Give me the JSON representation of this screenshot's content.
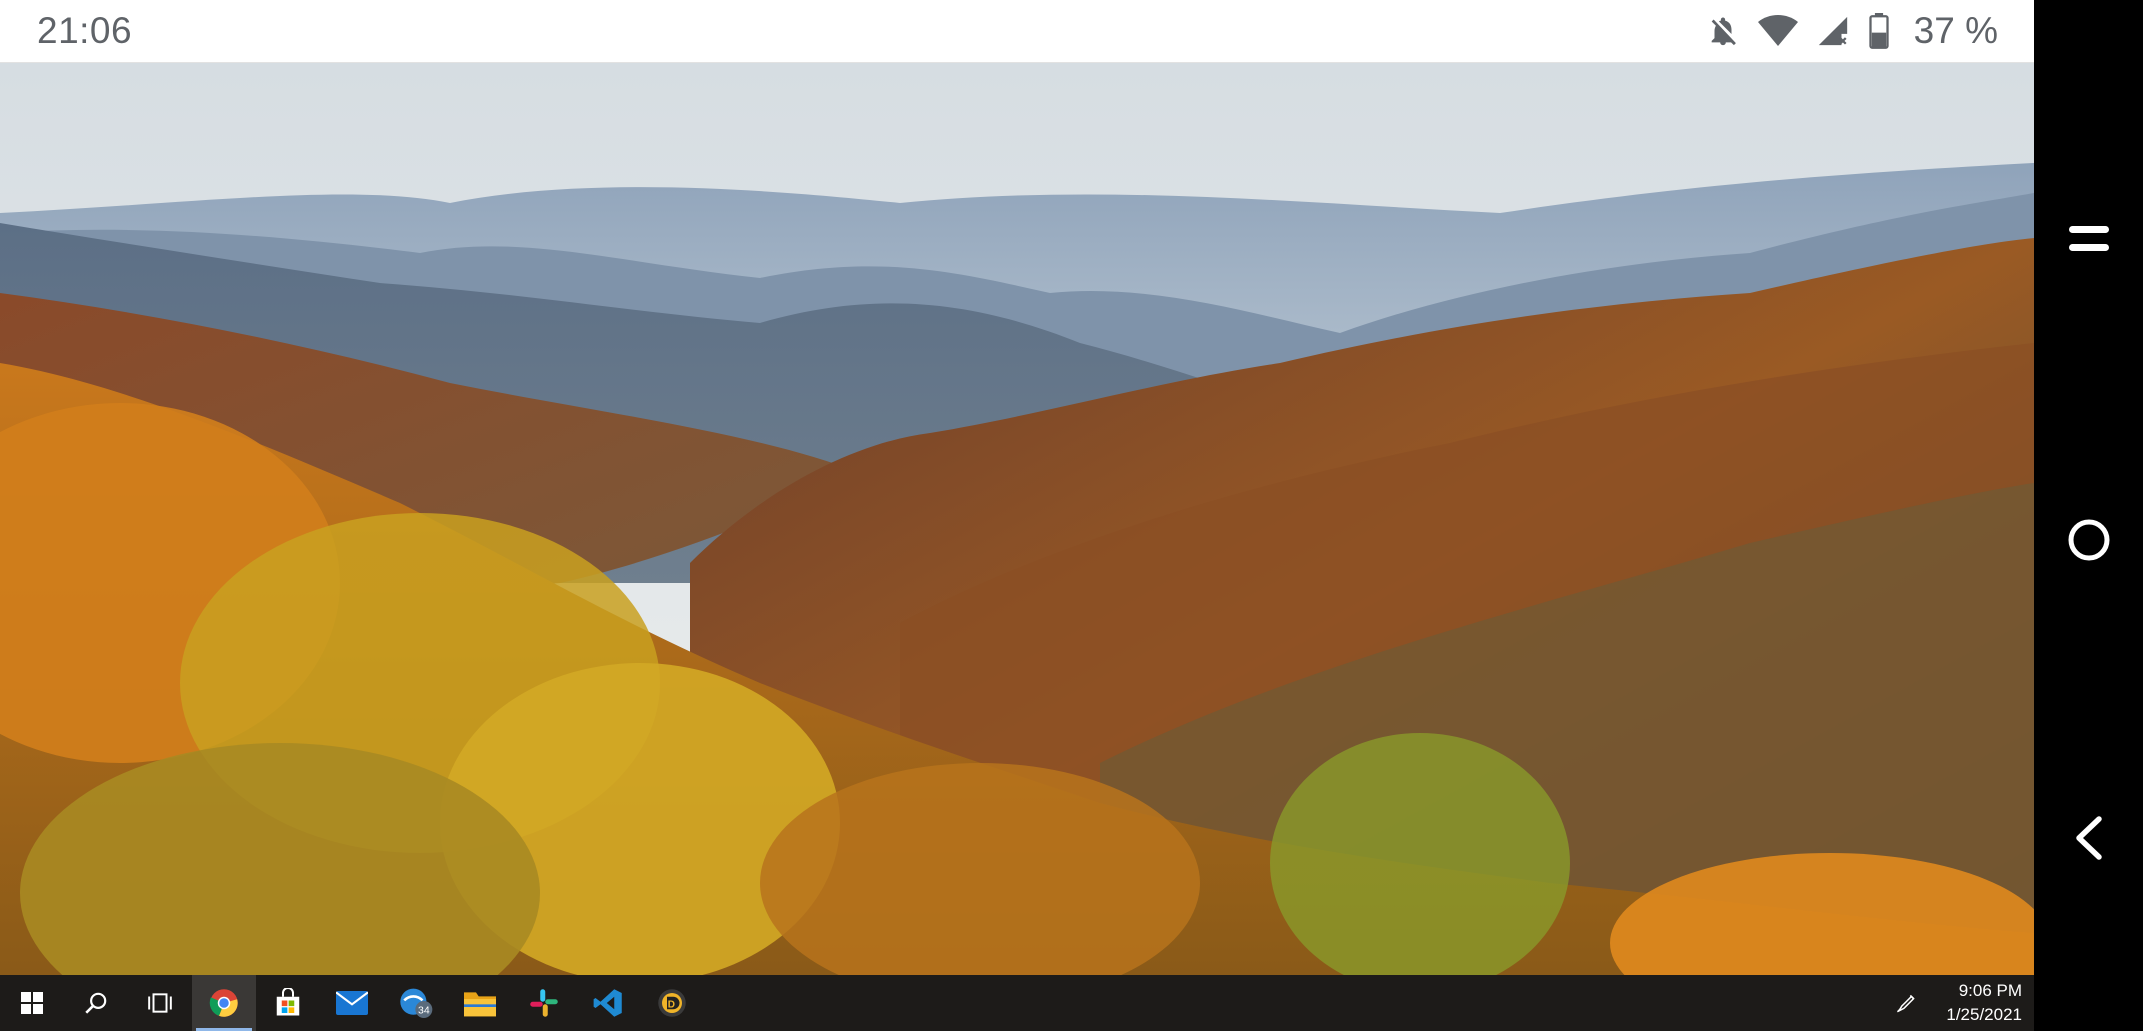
{
  "status_bar": {
    "time": "21:06",
    "battery_text": "37 %",
    "icons": [
      "notifications-off-icon",
      "wifi-icon",
      "cellular-signal-no-data-icon",
      "battery-icon"
    ]
  },
  "desktop": {
    "wallpaper": "autumn mountain valley"
  },
  "taskbar": {
    "apps": [
      {
        "name": "start-icon",
        "active": false
      },
      {
        "name": "search-icon",
        "active": false
      },
      {
        "name": "task-view-icon",
        "active": false
      },
      {
        "name": "chrome-icon",
        "active": true
      },
      {
        "name": "store-icon",
        "active": false
      },
      {
        "name": "mail-icon",
        "active": false
      },
      {
        "name": "app-badge-icon",
        "active": false,
        "badge": "34"
      },
      {
        "name": "file-explorer-icon",
        "active": false
      },
      {
        "name": "slack-icon",
        "active": false
      },
      {
        "name": "vscode-icon",
        "active": false
      },
      {
        "name": "media-app-icon",
        "active": false
      }
    ],
    "clock_time": "9:06 PM",
    "clock_date": "1/25/2021"
  },
  "nav_bar": {
    "buttons": [
      "recents-icon",
      "home-icon",
      "back-icon"
    ]
  },
  "colors": {
    "taskbar_bg": "#1d1b19",
    "status_bar_bg": "#ffffff",
    "nav_bar_bg": "#000000"
  }
}
